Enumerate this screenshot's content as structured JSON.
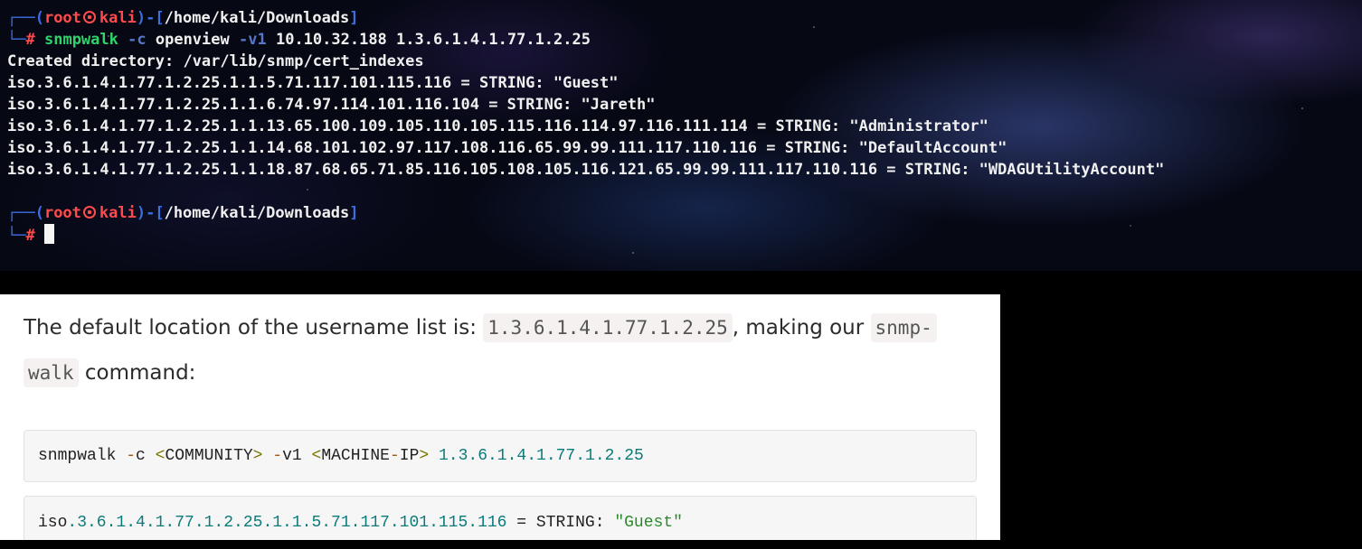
{
  "terminal": {
    "prompt1": {
      "dash_open": "┌──(",
      "user": "root",
      "host": "kali",
      "dash_mid": ")-[",
      "path": "/home/kali/Downloads",
      "close": "]"
    },
    "command_line": {
      "lead": "└─",
      "hash": "#",
      "cmd": "snmpwalk",
      "flag_c": "-c",
      "community": "openview",
      "flag_v": "-v1",
      "ip": "10.10.32.188",
      "oid": "1.3.6.1.4.1.77.1.2.25"
    },
    "output": [
      "Created directory: /var/lib/snmp/cert_indexes",
      "iso.3.6.1.4.1.77.1.2.25.1.1.5.71.117.101.115.116 = STRING: \"Guest\"",
      "iso.3.6.1.4.1.77.1.2.25.1.1.6.74.97.114.101.116.104 = STRING: \"Jareth\"",
      "iso.3.6.1.4.1.77.1.2.25.1.1.13.65.100.109.105.110.105.115.116.114.97.116.111.114 = STRING: \"Administrator\"",
      "iso.3.6.1.4.1.77.1.2.25.1.1.14.68.101.102.97.117.108.116.65.99.99.111.117.110.116 = STRING: \"DefaultAccount\"",
      "iso.3.6.1.4.1.77.1.2.25.1.1.18.87.68.65.71.85.116.105.108.105.116.121.65.99.99.111.117.110.116 = STRING: \"WDAGUtilityAccount\""
    ],
    "prompt2": {
      "dash_open": "┌──(",
      "user": "root",
      "host": "kali",
      "dash_mid": ")-[",
      "path": "/home/kali/Downloads",
      "close": "]"
    },
    "input_line": {
      "lead": "└─",
      "hash": "#"
    }
  },
  "article": {
    "para_prefix": "The default location of the username list is: ",
    "oid_code": "1.3.6.1.4.1.77.1.2.25",
    "para_mid": ", making our ",
    "cmd_code_a": "snmp-",
    "cmd_code_b": "walk",
    "para_suffix": " command:",
    "code1": {
      "cmd": "snmpwalk ",
      "d1": "-",
      "c": "c ",
      "lt1": "<",
      "community": "COMMUNITY",
      "gt1": ">",
      "sp1": " ",
      "d2": "-",
      "v1": "v1 ",
      "lt2": "<",
      "machine": "MACHINE",
      "d3": "-",
      "ip": "IP",
      "gt2": ">",
      "sp2": " ",
      "oid": "1.3.6.1.4.1.77.1.2.25"
    },
    "code2": {
      "iso": "iso",
      "oid": ".3.6.1.4.1.77.1.2.25.1.1.5.71.117.101.115.116",
      "eq": " = ",
      "type": "STRING",
      "colon": ": ",
      "val": "\"Guest\""
    }
  }
}
